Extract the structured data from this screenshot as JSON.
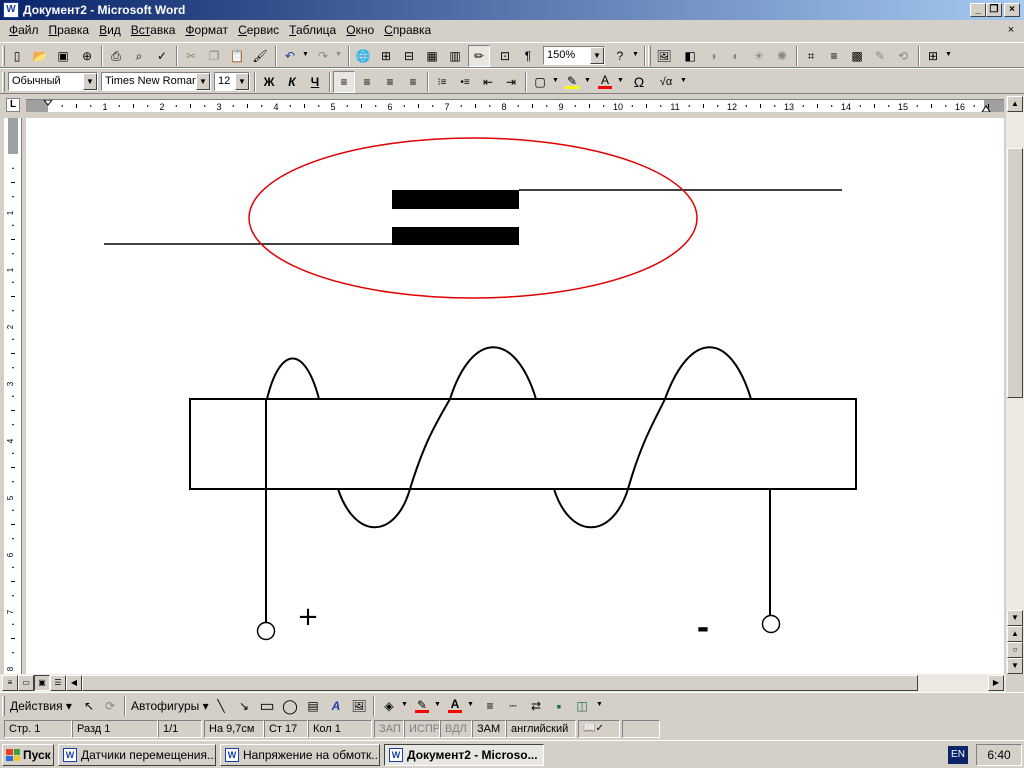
{
  "window": {
    "title": "Документ2 - Microsoft Word",
    "app_icon": "word-doc-icon",
    "controls": {
      "minimize": "_",
      "maximize": "❐",
      "close": "×"
    }
  },
  "menu": {
    "items": [
      {
        "first": "Ф",
        "rest": "айл"
      },
      {
        "first": "П",
        "rest": "равка"
      },
      {
        "first": "В",
        "rest": "ид"
      },
      {
        "first": "Вст",
        "rest": "авка"
      },
      {
        "first": "Ф",
        "rest": "ормат"
      },
      {
        "first": "С",
        "rest": "ервис"
      },
      {
        "first": "Т",
        "rest": "аблица"
      },
      {
        "first": "О",
        "rest": "кно"
      },
      {
        "first": "С",
        "rest": "правка"
      }
    ],
    "doc_close": "×"
  },
  "standard_toolbar": {
    "zoom": "150%",
    "icons": {
      "new": "▯",
      "open": "📂",
      "save": "▣",
      "permission": "⊕",
      "print": "⎙",
      "preview": "⌕",
      "spell": "✓",
      "cut": "✂",
      "copy": "❐",
      "paste": "📋",
      "format_painter": "🖌",
      "undo": "↶",
      "redo": "↷",
      "hyperlink": "🌐",
      "tables": "⊞",
      "insert_table": "⊟",
      "excel": "▦",
      "columns": "▥",
      "drawing": "✏",
      "doc_map": "⊡",
      "pilcrow": "¶",
      "help": "?",
      "picture": "🖼",
      "img1": "◧",
      "img2": "◑",
      "img3": "◐",
      "img4": "☀",
      "img5": "✺",
      "crop": "⌗",
      "line_style": "≡",
      "wrap": "▩",
      "format_pic": "✎",
      "reset": "⟲",
      "extra": "⊞"
    }
  },
  "formatting_toolbar": {
    "style": "Обычный",
    "font": "Times New Roman",
    "size": "12",
    "bold": "Ж",
    "italic": "К",
    "underline": "Ч",
    "icons": {
      "align_left": "≡",
      "center": "≡",
      "align_right": "≡",
      "justify": "≡",
      "numbering": "⁝≡",
      "bullets": "•≡",
      "outdent": "⇤",
      "indent": "⇥",
      "borders": "▢",
      "highlight": "✎",
      "font_color": "A",
      "symbol": "Ω",
      "formula": "√α"
    },
    "colors": {
      "highlight": "#ffff00",
      "font_color": "#ff0000"
    }
  },
  "ruler": {
    "corner": "L",
    "numbers": [
      "1",
      "2",
      "3",
      "4",
      "5",
      "6",
      "7",
      "8",
      "9",
      "10",
      "11",
      "12",
      "13",
      "14",
      "15",
      "16"
    ],
    "vnumbers": [
      "1",
      "1",
      "2",
      "3",
      "4",
      "5",
      "6",
      "7",
      "8"
    ]
  },
  "document": {
    "annotation_color": "#e00000",
    "plus_terminal": "+",
    "minus_terminal": "-"
  },
  "draw_toolbar": {
    "actions": "Действия",
    "autoshapes": "Автофигуры",
    "icons": {
      "select": "↖",
      "rotate": "⟳",
      "line": "╲",
      "arrow": "↘",
      "rect": "▭",
      "oval": "◯",
      "textbox": "▤",
      "wordart": "A",
      "clipart": "🖼",
      "fill": "◈",
      "linecolor": "✎",
      "fontcolor": "A",
      "linestyle": "≡",
      "dashstyle": "┄",
      "arrowstyle": "⇄",
      "shadow": "▪",
      "3d": "◫"
    }
  },
  "status_bar": {
    "page": "Стр.  1",
    "section": "Разд  1",
    "pages": "1/1",
    "at": "На  9,7см",
    "line": "Ст  17",
    "col": "Кол  1",
    "rec": "ЗАП",
    "trk": "ИСПР",
    "ext": "ВДЛ",
    "ovr": "ЗАМ",
    "lang": "английский",
    "spell_icon": "📖✓"
  },
  "taskbar": {
    "start": "Пуск",
    "tasks": [
      {
        "label": "Датчики перемещения...",
        "active": false
      },
      {
        "label": "Напряжение на обмотк...",
        "active": false
      },
      {
        "label": "Документ2 - Microso...",
        "active": true
      }
    ],
    "lang": "EN",
    "clock": "6:40"
  }
}
